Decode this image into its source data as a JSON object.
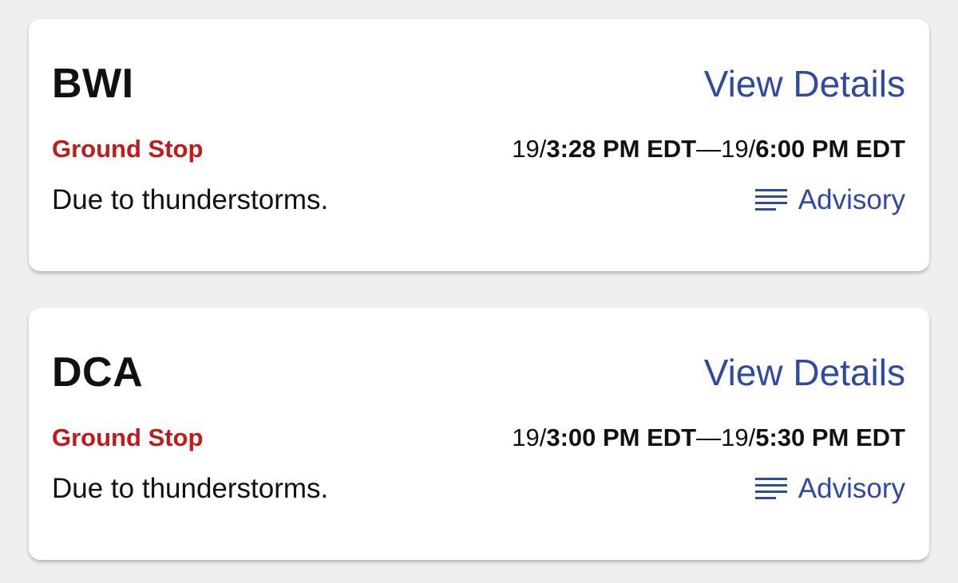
{
  "colors": {
    "background": "#efefef",
    "card": "#ffffff",
    "link": "#2f4a9e",
    "status": "#c01a1a",
    "text": "#111111"
  },
  "cards": [
    {
      "code": "BWI",
      "view_details": "View Details",
      "status": "Ground Stop",
      "start_day": "19/",
      "start_time": "3:28 PM EDT",
      "separator": "—",
      "end_day": "19/",
      "end_time": "6:00 PM EDT",
      "reason": "Due to thunderstorms.",
      "advisory_icon": "lines-icon",
      "advisory": "Advisory"
    },
    {
      "code": "DCA",
      "view_details": "View Details",
      "status": "Ground Stop",
      "start_day": "19/",
      "start_time": "3:00 PM EDT",
      "separator": "—",
      "end_day": "19/",
      "end_time": "5:30 PM EDT",
      "reason": "Due to thunderstorms.",
      "advisory_icon": "lines-icon",
      "advisory": "Advisory"
    }
  ]
}
